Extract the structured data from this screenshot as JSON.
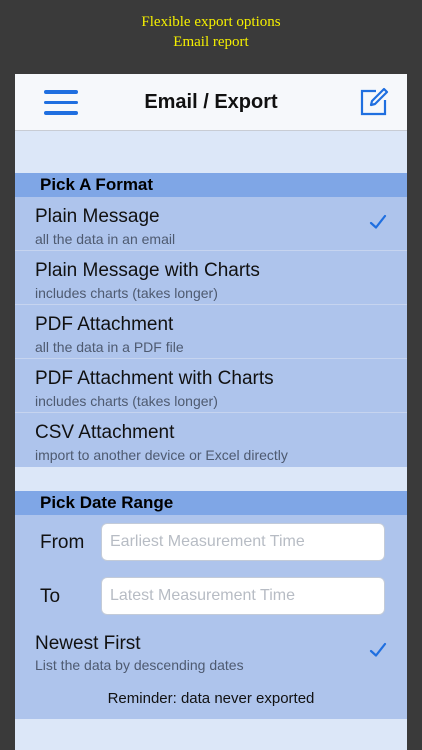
{
  "caption": {
    "line1": "Flexible export options",
    "line2": "Email report"
  },
  "navbar": {
    "title": "Email / Export",
    "left_icon": "hamburger-menu-icon",
    "right_icon": "compose-icon",
    "accent_color": "#1f6fe0"
  },
  "format_section": {
    "header": "Pick A Format",
    "items": [
      {
        "title": "Plain Message",
        "subtitle": "all the data in an email",
        "checked": true
      },
      {
        "title": "Plain Message with Charts",
        "subtitle": "includes charts (takes longer)",
        "checked": false
      },
      {
        "title": "PDF Attachment",
        "subtitle": "all the data in a PDF file",
        "checked": false
      },
      {
        "title": "PDF Attachment with Charts",
        "subtitle": "includes charts (takes longer)",
        "checked": false
      },
      {
        "title": "CSV Attachment",
        "subtitle": "import to another device or Excel directly",
        "checked": false
      }
    ]
  },
  "date_section": {
    "header": "Pick Date Range",
    "from_label": "From",
    "from_placeholder": "Earliest Measurement Time",
    "to_label": "To",
    "to_placeholder": "Latest Measurement Time",
    "newest_title": "Newest First",
    "newest_subtitle": "List the data by descending dates",
    "newest_checked": true,
    "reminder": "Reminder: data never exported"
  }
}
